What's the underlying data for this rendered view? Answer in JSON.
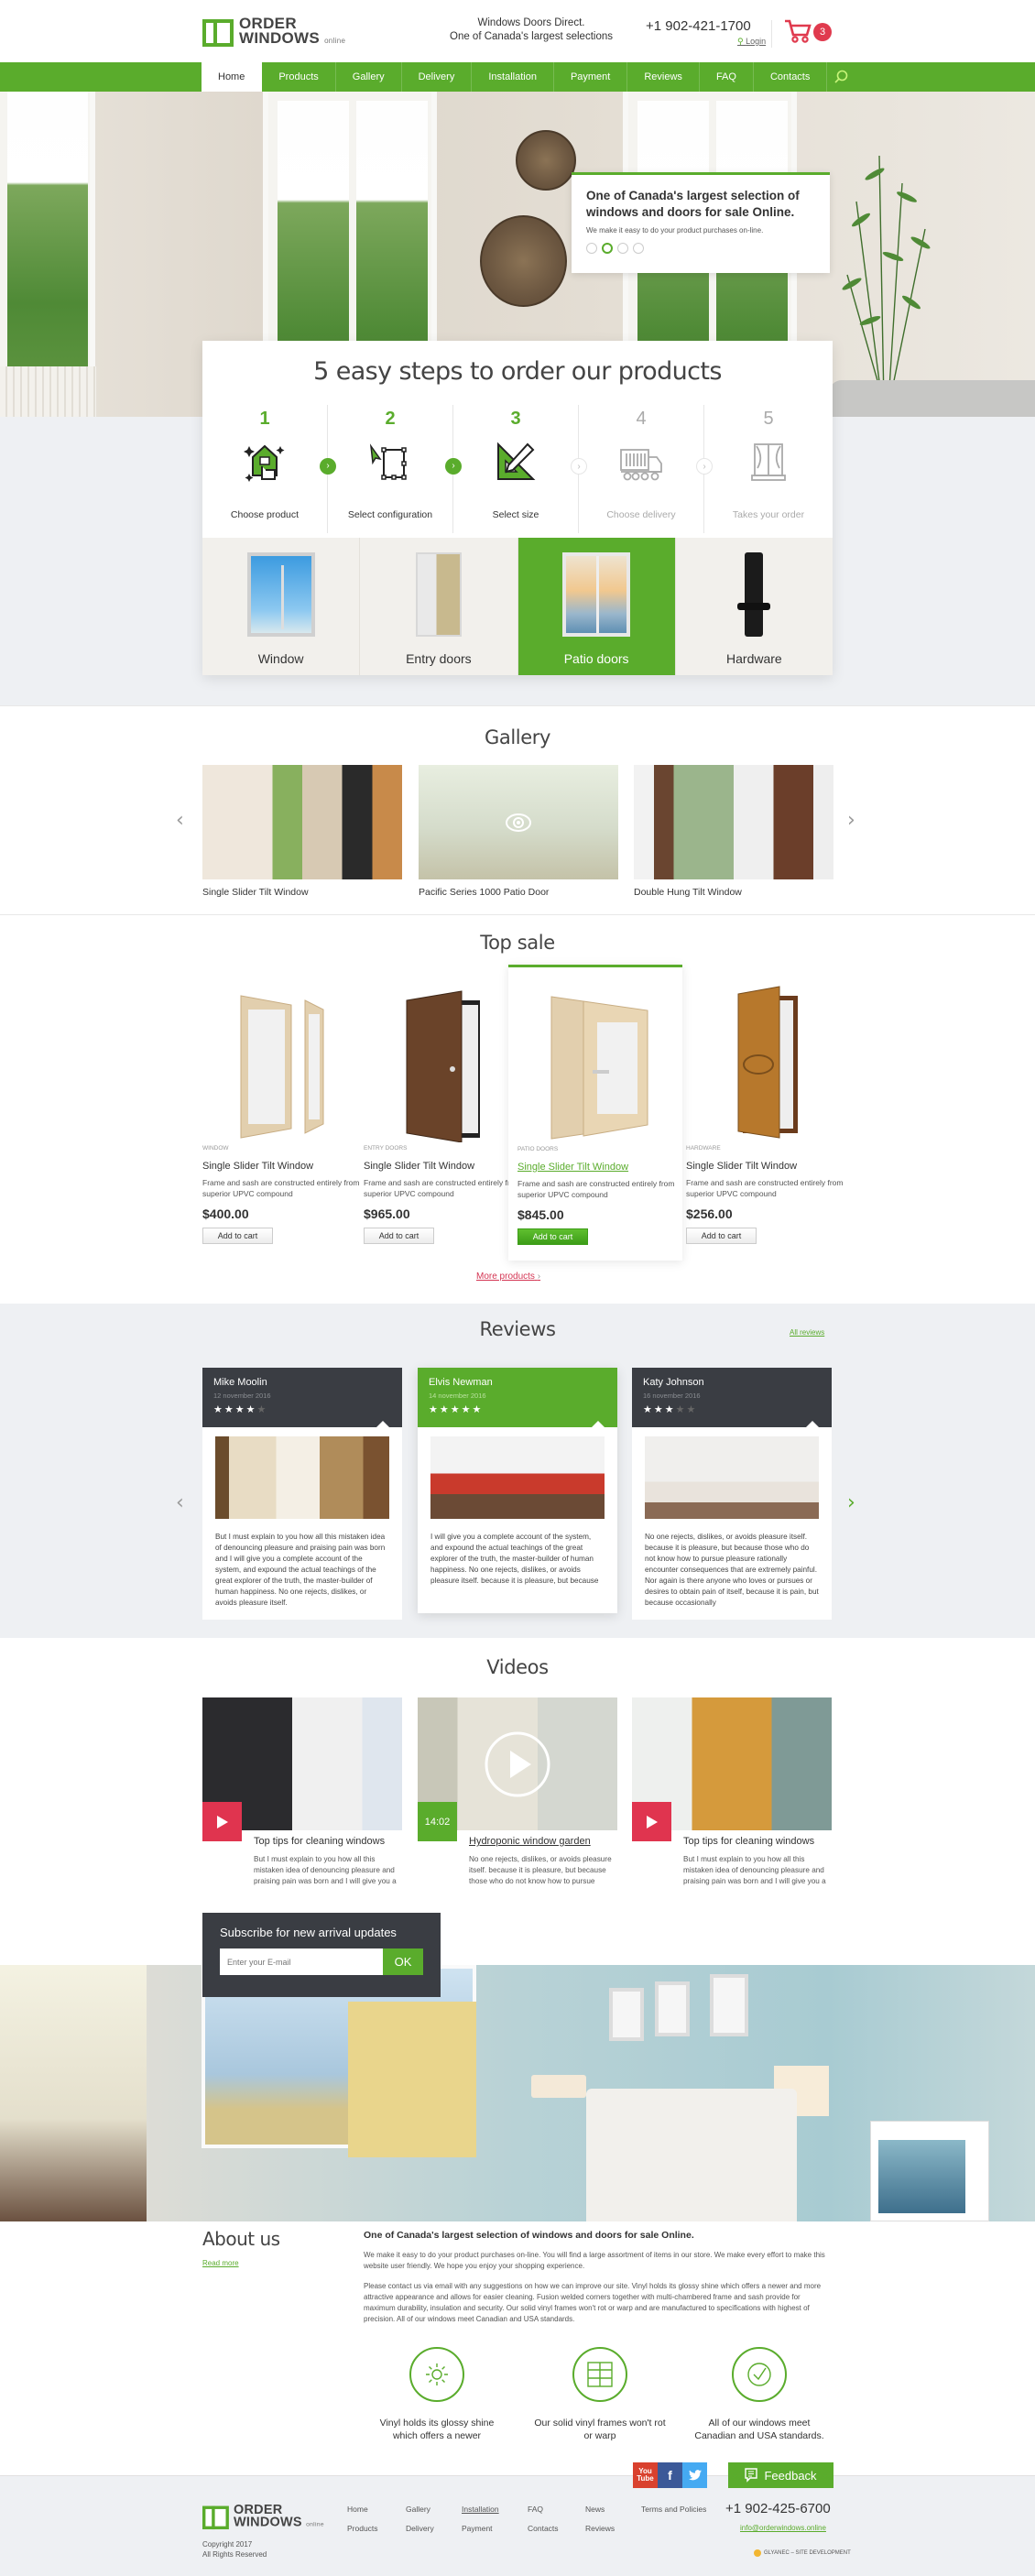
{
  "header": {
    "logo_top": "ORDER",
    "logo_bottom": "WINDOWS",
    "logo_suffix": "online",
    "tagline_1": "Windows Doors Direct.",
    "tagline_2": "One of Canada's largest selections",
    "phone": "+1 902-421-1700",
    "login": "Login",
    "cart_count": "3"
  },
  "nav": {
    "items": [
      "Home",
      "Products",
      "Gallery",
      "Delivery",
      "Installation",
      "Payment",
      "Reviews",
      "FAQ",
      "Contacts"
    ],
    "active": "Home"
  },
  "hero": {
    "title": "One of Canada's largest selection of windows and doors for sale Online.",
    "subtitle": "We make it easy to do your product purchases on-line.",
    "slides": 4,
    "active_slide": 2
  },
  "steps": {
    "title": "5 easy steps to order our products",
    "items": [
      {
        "num": "1",
        "label": "Choose product",
        "done": true
      },
      {
        "num": "2",
        "label": "Select configuration",
        "done": true
      },
      {
        "num": "3",
        "label": "Select size",
        "done": true
      },
      {
        "num": "4",
        "label": "Choose delivery",
        "done": false
      },
      {
        "num": "5",
        "label": "Takes your order",
        "done": false
      }
    ],
    "categories": [
      "Window",
      "Entry doors",
      "Patio doors",
      "Hardware"
    ],
    "active_category": "Patio doors"
  },
  "gallery": {
    "title": "Gallery",
    "items": [
      "Single Slider Tilt Window",
      "Pacific Series 1000 Patio Door",
      "Double Hung Tilt Window"
    ]
  },
  "top_sale": {
    "title": "Top sale",
    "products": [
      {
        "category": "Window",
        "title": "Single Slider Tilt Window",
        "desc": "Frame and sash are constructed entirely from superior UPVC compound",
        "price": "$400.00",
        "button": "Add to cart"
      },
      {
        "category": "Entry doors",
        "title": "Single Slider Tilt Window",
        "desc": "Frame and sash are constructed entirely from superior UPVC compound",
        "price": "$965.00",
        "button": "Add to cart"
      },
      {
        "category": "Patio doors",
        "title": "Single Slider Tilt Window",
        "desc": "Frame and sash are constructed entirely from superior UPVC compound",
        "price": "$845.00",
        "button": "Add to cart"
      },
      {
        "category": "Hardware",
        "title": "Single Slider Tilt Window",
        "desc": "Frame and sash are constructed entirely from superior UPVC compound",
        "price": "$256.00",
        "button": "Add to cart"
      }
    ],
    "more": "More products"
  },
  "reviews": {
    "title": "Reviews",
    "all_link": "All reviews",
    "items": [
      {
        "name": "Mike Moolin",
        "date": "12 november 2016",
        "rating": 4,
        "text": "But I must explain to you how all this mistaken idea of denouncing pleasure and praising pain was born and I will give you a complete account of the system, and expound the actual teachings of the great explorer of the truth, the master-builder of human happiness. No one rejects, dislikes, or avoids pleasure itself."
      },
      {
        "name": "Elvis Newman",
        "date": "14 november 2016",
        "rating": 5,
        "text": "I will give you a complete account of the system, and expound the actual teachings of the great explorer of the truth, the master-builder of human happiness. No one rejects, dislikes, or avoids pleasure itself. because it is pleasure, but because"
      },
      {
        "name": "Katy Johnson",
        "date": "16 november 2016",
        "rating": 3,
        "text": "No one rejects, dislikes, or avoids pleasure itself. because it is pleasure, but because those who do not know how to pursue pleasure rationally encounter consequences that are extremely painful. Nor again is there anyone who loves or pursues or desires to obtain pain of itself, because it is pain, but because occasionally"
      }
    ]
  },
  "videos": {
    "title": "Videos",
    "items": [
      {
        "title": "Top tips for cleaning windows",
        "desc": "But I must explain to you how all this mistaken idea of denouncing pleasure and praising pain was born and I will give you a",
        "duration": ""
      },
      {
        "title": "Hydroponic window garden",
        "desc": "No one rejects, dislikes, or avoids pleasure itself. because it is pleasure, but because those who do not know how to pursue",
        "duration": "14:02"
      },
      {
        "title": "Top tips for cleaning windows",
        "desc": "But I must explain to you how all this mistaken idea of denouncing pleasure and praising pain was born and I will give you a",
        "duration": ""
      }
    ]
  },
  "subscribe": {
    "title": "Subscribe for new arrival updates",
    "placeholder": "Enter your E-mail",
    "button": "OK"
  },
  "about": {
    "title": "About us",
    "read_more": "Read more",
    "heading": "One of Canada's largest selection of windows and doors for sale Online.",
    "p1": "We make it easy to do your product purchases on-line. You will find a large assortment of items in our store. We make every effort to make this website user friendly. We hope you enjoy your shopping experience.",
    "p2": "Please contact us via email with any suggestions on how we can improve our site. Vinyl holds its glossy shine which offers a newer and more attractive appearance and allows for easier cleaning. Fusion welded corners together with multi-chambered frame and sash provide for maximum durability, insulation and security. Our solid vinyl frames won't rot or warp and are manufactured to specifications with highest of precision. All of our windows meet Canadian and USA standards.",
    "features": [
      {
        "icon": "sun-icon",
        "label": "Vinyl holds its glossy shine which offers a newer"
      },
      {
        "icon": "window-grid-icon",
        "label": "Our solid vinyl frames won't rot or warp"
      },
      {
        "icon": "check-circle-icon",
        "label": "All of our windows meet Canadian and USA standards."
      }
    ]
  },
  "footer": {
    "social": [
      "YouTube",
      "f",
      "t"
    ],
    "feedback": "Feedback",
    "links": [
      [
        "Home",
        "Products"
      ],
      [
        "Gallery",
        "Delivery"
      ],
      [
        "Installation",
        "Payment"
      ],
      [
        "FAQ",
        "Contacts"
      ],
      [
        "News",
        "Reviews"
      ],
      [
        "Terms and Policies"
      ]
    ],
    "phone": "+1 902-425-6700",
    "email": "info@orderwindows.online",
    "copyright_1": "Copyright 2017",
    "copyright_2": "All Rights Reserved",
    "developer": "GLYANEC – SITE DEVELOPMENT"
  },
  "colors": {
    "brand_green": "#5aac2c",
    "accent_red": "#e0344f",
    "dark": "#3a3d43"
  }
}
